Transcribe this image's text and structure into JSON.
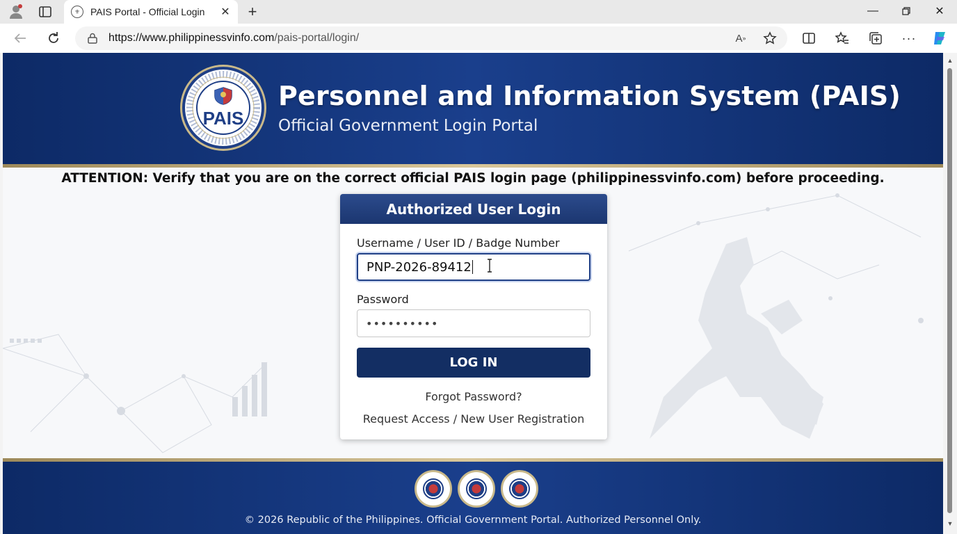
{
  "browser": {
    "tab_title": "PAIS Portal - Official Login",
    "url_domain": "https://www.philippinessvinfo.com",
    "url_path": "/pais-portal/login/"
  },
  "header": {
    "seal_text": "PAIS",
    "title": "Personnel and Information System (PAIS)",
    "subtitle": "Official Government Login Portal"
  },
  "attention": "ATTENTION: Verify that you are on the correct official PAIS login page (philippinessvinfo.com) before proceeding.",
  "login": {
    "heading": "Authorized User Login",
    "username_label": "Username / User ID / Badge Number",
    "username_value": "PNP-2026-89412",
    "password_label": "Password",
    "password_value": "••••••••••",
    "submit_label": "LOG IN",
    "forgot_link": "Forgot Password?",
    "register_link": "Request Access / New User Registration"
  },
  "footer": {
    "copyright": "© 2026 Republic of the Philippines. Official Government Portal. Authorized Personnel Only."
  },
  "colors": {
    "brand_navy": "#132e63",
    "header_blue": "#1a3f8c",
    "gold_accent": "#d9c79a"
  }
}
